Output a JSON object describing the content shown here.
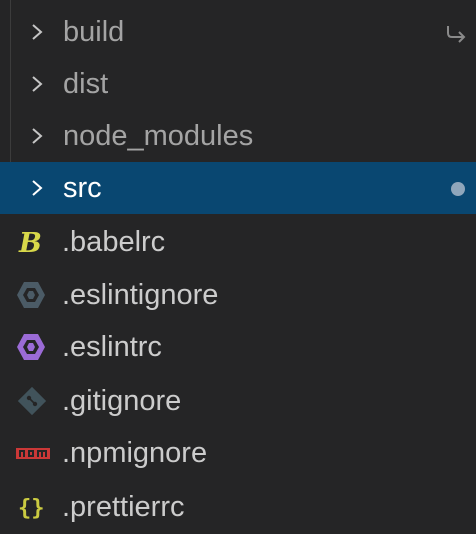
{
  "explorer": {
    "items": [
      {
        "type": "folder",
        "label": "build",
        "icon": "chevron-right-icon",
        "trailing_icon": "symlink-arrow-icon"
      },
      {
        "type": "folder",
        "label": "dist",
        "icon": "chevron-right-icon"
      },
      {
        "type": "folder",
        "label": "node_modules",
        "icon": "chevron-right-icon"
      },
      {
        "type": "folder",
        "label": "src",
        "icon": "chevron-right-icon",
        "selected": true,
        "trailing_icon": "modified-dot-icon"
      },
      {
        "type": "file",
        "label": ".babelrc",
        "icon": "babel-icon",
        "icon_color": "#d8d84a"
      },
      {
        "type": "file",
        "label": ".eslintignore",
        "icon": "eslint-ignore-icon",
        "icon_color": "#4b5b66"
      },
      {
        "type": "file",
        "label": ".eslintrc",
        "icon": "eslint-icon",
        "icon_color": "#9b6bd6"
      },
      {
        "type": "file",
        "label": ".gitignore",
        "icon": "git-icon",
        "icon_color": "#41535b"
      },
      {
        "type": "file",
        "label": ".npmignore",
        "icon": "npm-icon",
        "icon_color": "#cb3837"
      },
      {
        "type": "file",
        "label": ".prettierrc",
        "icon": "json-braces-icon",
        "icon_color": "#cbcb41"
      }
    ]
  },
  "colors": {
    "background": "#252526",
    "selection": "#094771",
    "folder_text": "#a4a4a4",
    "file_text": "#cccccc"
  }
}
